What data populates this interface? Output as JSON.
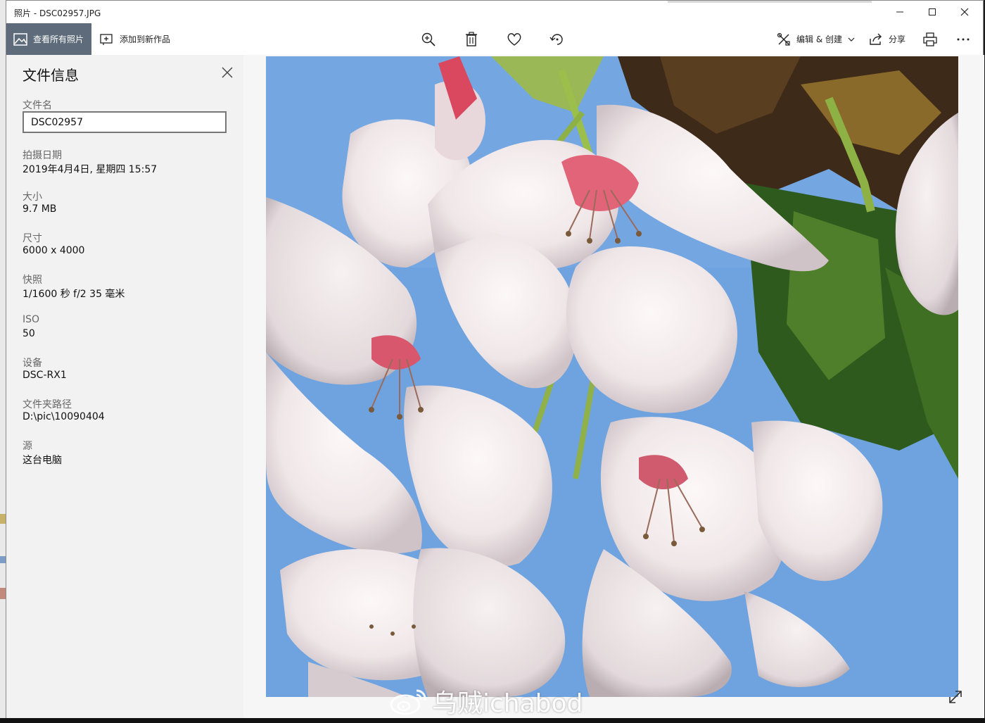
{
  "window": {
    "title": "照片 - DSC02957.JPG",
    "controls": [
      "minimize",
      "maximize",
      "close"
    ]
  },
  "toolbar": {
    "view_all_label": "查看所有照片",
    "add_to_creation_label": "添加到新作品",
    "edit_create_label": "编辑 & 创建",
    "share_label": "分享",
    "icons": [
      "zoom-in-icon",
      "delete-icon",
      "heart-icon",
      "rotate-icon",
      "print-icon",
      "more-icon"
    ]
  },
  "file_info": {
    "title": "文件信息",
    "filename_label": "文件名",
    "filename_value": "DSC02957",
    "fields": [
      {
        "label": "拍摄日期",
        "value": "2019年4月4日, 星期四 15:57"
      },
      {
        "label": "大小",
        "value": "9.7 MB"
      },
      {
        "label": "尺寸",
        "value": "6000 x 4000"
      },
      {
        "label": "快照",
        "value": "1/1600 秒 f/2 35 毫米"
      },
      {
        "label": "ISO",
        "value": "50"
      },
      {
        "label": "设备",
        "value": "DSC-RX1"
      },
      {
        "label": "文件夹路径",
        "value": "D:\\pic\\10090404"
      },
      {
        "label": "源",
        "value": "这台电脑"
      }
    ]
  },
  "watermark": {
    "text": "乌贼ichabod"
  },
  "colors": {
    "accent_button": "#5d6b7a",
    "panel_bg": "#f2f2f2",
    "sky": "#6ea0dc"
  }
}
